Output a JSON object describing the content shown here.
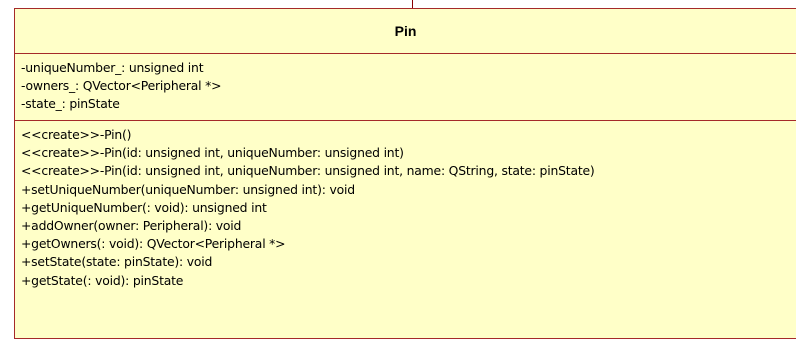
{
  "class_box": {
    "name": "Pin",
    "attributes": [
      "-uniqueNumber_: unsigned int",
      "-owners_: QVector<Peripheral *>",
      "-state_: pinState"
    ],
    "operations": [
      "<<create>>-Pin()",
      "<<create>>-Pin(id: unsigned int, uniqueNumber: unsigned int)",
      "<<create>>-Pin(id: unsigned int, uniqueNumber: unsigned int, name: QString, state: pinState)",
      "+setUniqueNumber(uniqueNumber: unsigned int): void",
      "+getUniqueNumber(: void): unsigned int",
      "+addOwner(owner: Peripheral): void",
      "+getOwners(: void): QVector<Peripheral *>",
      "+setState(state: pinState): void",
      "+getState(: void): pinState"
    ]
  },
  "colors": {
    "fill": "#ffffc8",
    "border": "#a52a2a"
  }
}
